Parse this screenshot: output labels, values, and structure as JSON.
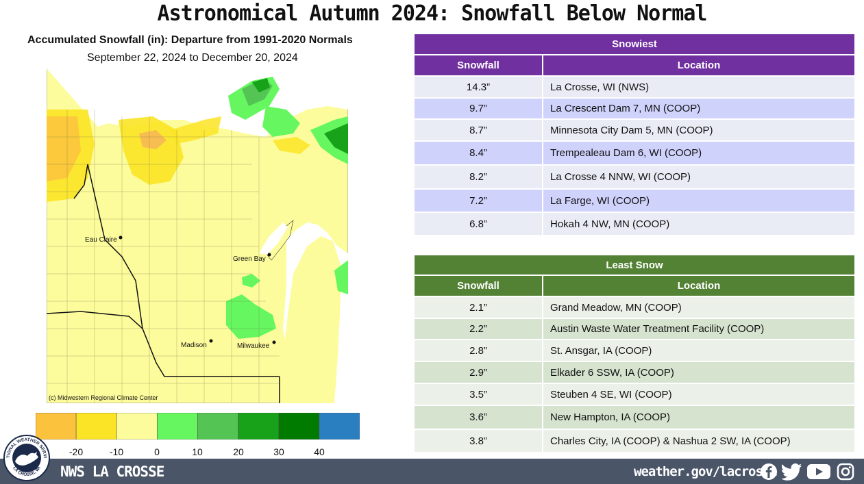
{
  "title": "Astronomical Autumn 2024:  Snowfall Below Normal",
  "map": {
    "title": "Accumulated Snowfall (in): Departure from 1991-2020 Normals",
    "dates": "September 22, 2024 to December 20, 2024",
    "credit": "(c) Midwestern Regional Climate Center",
    "cities": [
      {
        "name": "Eau Claire"
      },
      {
        "name": "Green Bay"
      },
      {
        "name": "Madison"
      },
      {
        "name": "Milwaukee"
      }
    ],
    "scale": {
      "colors": [
        "#fbc23e",
        "#fbe425",
        "#fdfc9c",
        "#66f760",
        "#54c554",
        "#17a21a",
        "#017a00",
        "#2a7fc0"
      ],
      "labels": [
        "-20",
        "-10",
        "0",
        "10",
        "20",
        "30",
        "40"
      ]
    }
  },
  "snowiest": {
    "banner": "Snowiest",
    "color": "#7030a0",
    "header_snowfall": "Snowfall",
    "header_location": "Location",
    "rows": [
      {
        "snowfall": "14.3”",
        "location": "La Crosse, WI (NWS)"
      },
      {
        "snowfall": "9.7”",
        "location": "La Crescent Dam 7, MN (COOP)"
      },
      {
        "snowfall": "8.7”",
        "location": "Minnesota City Dam 5, MN (COOP)"
      },
      {
        "snowfall": "8.4”",
        "location": "Trempealeau Dam 6, WI (COOP)"
      },
      {
        "snowfall": "8.2”",
        "location": "La Crosse 4 NNW, WI (COOP)"
      },
      {
        "snowfall": "7.2”",
        "location": "La Farge, WI (COOP)"
      },
      {
        "snowfall": "6.8”",
        "location": "Hokah 4 NW, MN (COOP)"
      }
    ]
  },
  "least": {
    "banner": "Least Snow",
    "color": "#548235",
    "header_snowfall": "Snowfall",
    "header_location": "Location",
    "rows": [
      {
        "snowfall": "2.1”",
        "location": "Grand Meadow, MN (COOP)"
      },
      {
        "snowfall": "2.2”",
        "location": "Austin Waste Water Treatment Facility (COOP)"
      },
      {
        "snowfall": "2.8”",
        "location": "St. Ansgar, IA (COOP)"
      },
      {
        "snowfall": "2.9”",
        "location": "Elkader 6 SSW, IA (COOP)"
      },
      {
        "snowfall": "3.5”",
        "location": "Steuben 4 SE, WI (COOP)"
      },
      {
        "snowfall": "3.6”",
        "location": "New Hampton, IA (COOP)"
      },
      {
        "snowfall": "3.8”",
        "location": "Charles City, IA (COOP) & Nashua 2 SW, IA (COOP)"
      }
    ]
  },
  "footer": {
    "brand": "NWS LA CROSSE",
    "url": "weather.gov/lacrosse",
    "seal_top": "NATIONAL WEATHER SERVICE",
    "seal_bottom": "LA CROSSE, WI",
    "social": [
      "facebook-icon",
      "twitter-icon",
      "youtube-icon",
      "instagram-icon"
    ]
  }
}
